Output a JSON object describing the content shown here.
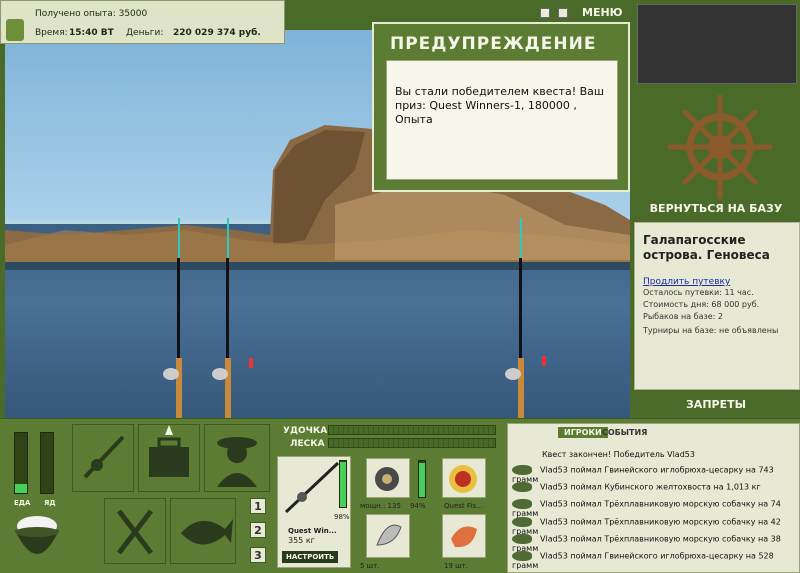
{
  "top_info": {
    "exp_gained": "Получено опыта: 35000",
    "time_label": "Время:",
    "time_value": "15:40 ВТ",
    "money_label": "Деньги:",
    "money_value": "220 029 374 руб."
  },
  "menu_label": "МЕНЮ",
  "warning": {
    "title": "ПРЕДУПРЕЖДЕНИЕ",
    "message": "Вы стали победителем квеста! Ваш приз: Quest Winners-1, 180000 , Опыта"
  },
  "right_panel": {
    "return_base": "ВЕРНУТЬСЯ НА БАЗУ",
    "location": "Галапагосские острова. Геновеса",
    "extend_link": "Продлить путевку",
    "lines": [
      "Осталось путевки: 11 час.",
      "Стоимость дня: 68 000 руб.",
      "Рыбаков на базе: 2",
      "Турниры на базе: не объявлены"
    ],
    "bans": "ЗАПРЕТЫ"
  },
  "status_bars": {
    "food_label": "ЕДА",
    "poison_label": "ЯД",
    "food_level": 0.15,
    "poison_level": 0.0
  },
  "slot_buttons": [
    "1",
    "2",
    "3"
  ],
  "gear": {
    "rod_label": "УДОЧКА",
    "line_label": "ЛЕСКА",
    "rod_name": "Quest Win...",
    "rod_weight": "355 кг",
    "rod_pct": "98%",
    "setup_button": "НАСТРОИТЬ",
    "reel_text": "мощн.: 135",
    "reel_pct": "94%",
    "line_name": "Quest Fis...",
    "hook_count": "5 шт.",
    "bait_count": "19 шт."
  },
  "log": {
    "tab_players": "ИГРОКИ",
    "tab_events": "СОБЫТИЯ",
    "header": "Квест закончен! Победитель Vlad53",
    "entries": [
      "Vlad53 поймал Гвинейского иглобрюха-цесарку на 743 грамм",
      "Vlad53 поймал Кубинского желтохвоста на 1,013 кг",
      "Vlad53 поймал Трёхплавниковую морскую собачку на 74 грамм",
      "Vlad53 поймал Трёхплавниковую морскую собачку на 42 грамм",
      "Vlad53 поймал Трёхплавниковую морскую собачку на 38 грамм",
      "Vlad53 поймал Гвинейского иглобрюха-цесарку на 528 грамм"
    ]
  },
  "colors": {
    "panel": "#5b7c32",
    "accent": "#47d15a",
    "link": "#1a2aa8"
  }
}
